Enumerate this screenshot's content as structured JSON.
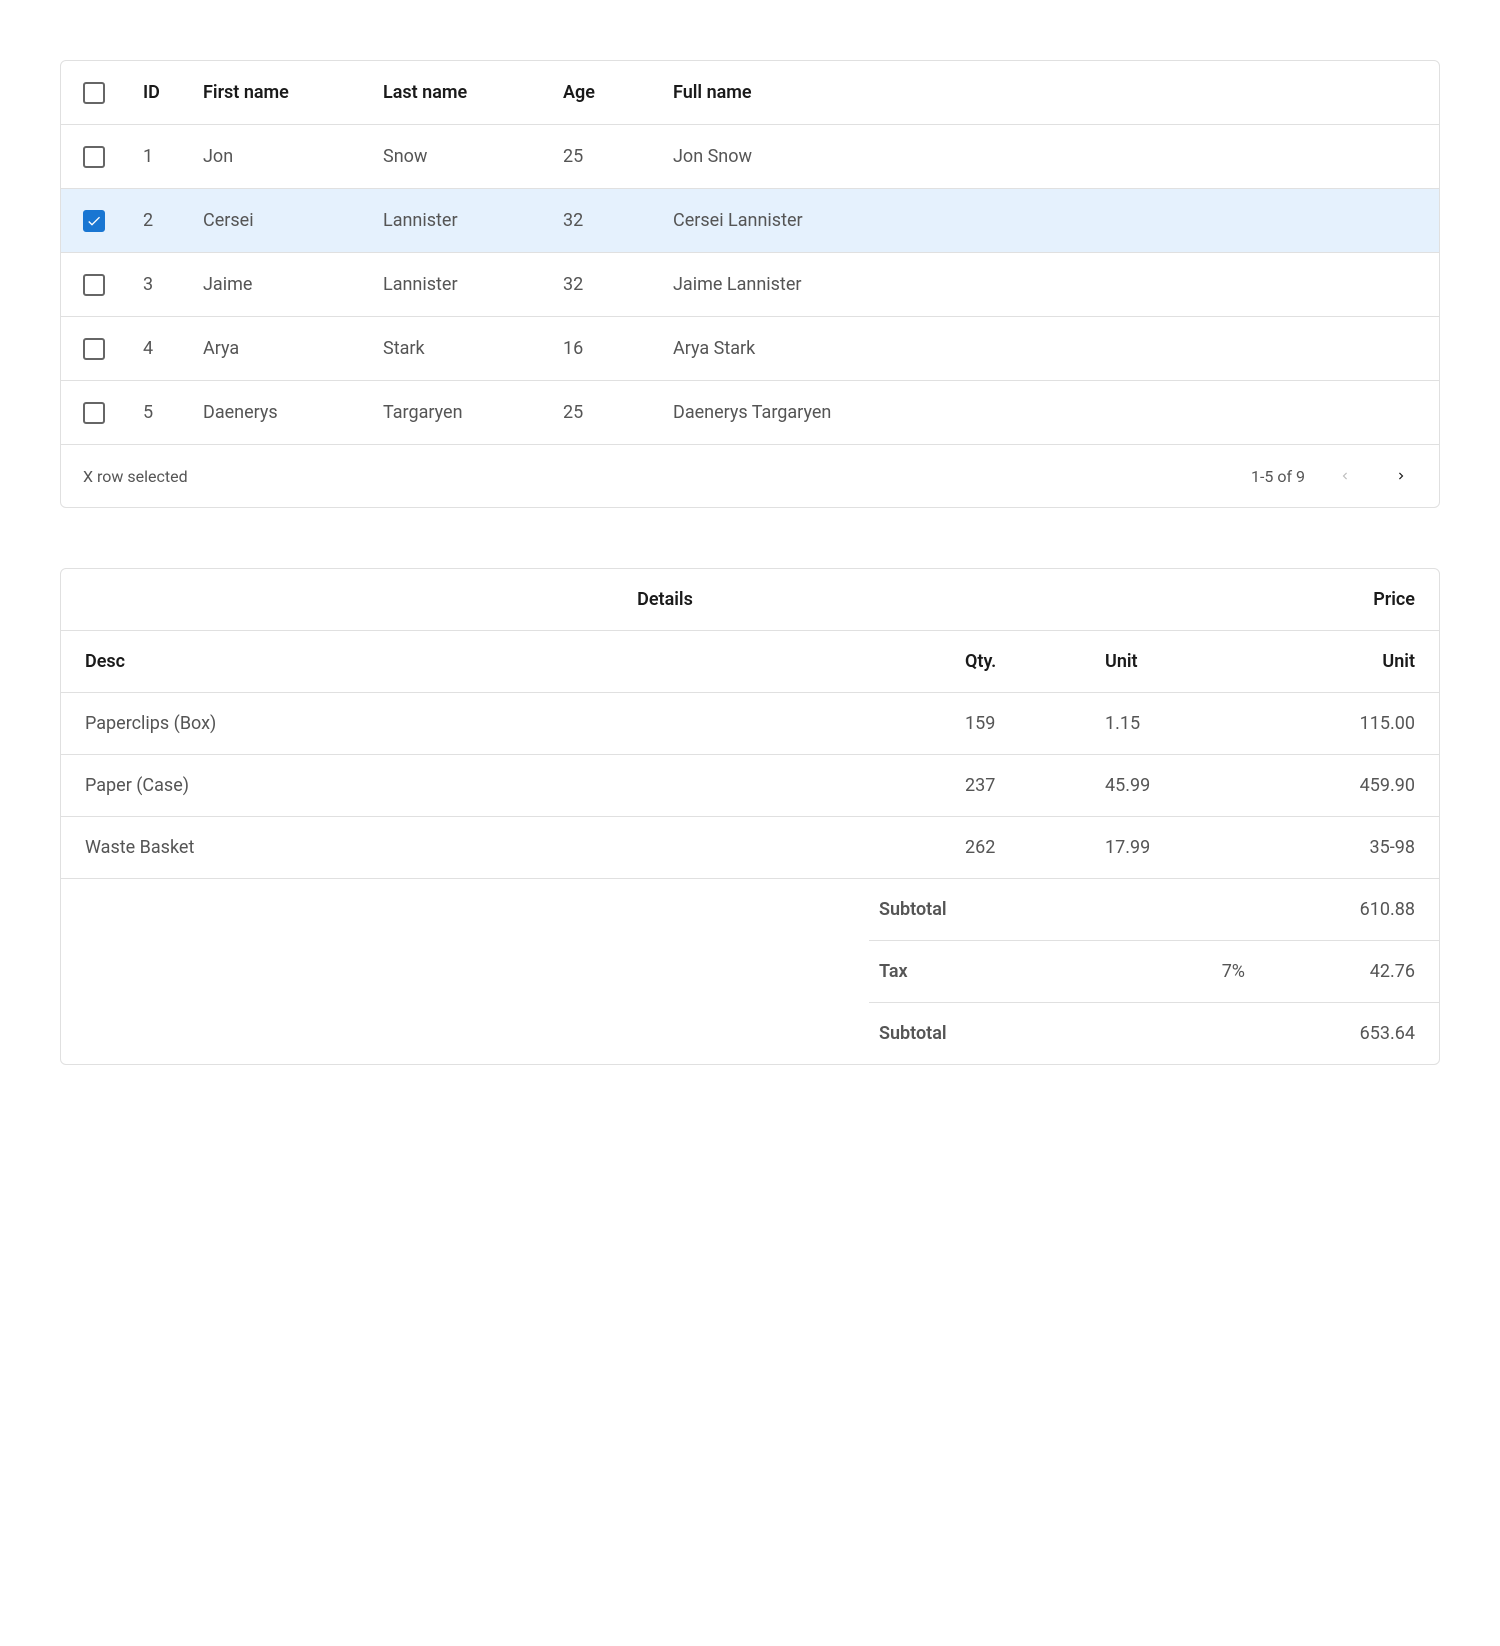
{
  "grid": {
    "headers": {
      "id": "ID",
      "first": "First name",
      "last": "Last name",
      "age": "Age",
      "full": "Full name"
    },
    "rows": [
      {
        "id": "1",
        "first": "Jon",
        "last": "Snow",
        "age": "25",
        "full": "Jon Snow",
        "selected": false
      },
      {
        "id": "2",
        "first": "Cersei",
        "last": "Lannister",
        "age": "32",
        "full": "Cersei Lannister",
        "selected": true
      },
      {
        "id": "3",
        "first": "Jaime",
        "last": "Lannister",
        "age": "32",
        "full": "Jaime Lannister",
        "selected": false
      },
      {
        "id": "4",
        "first": "Arya",
        "last": "Stark",
        "age": "16",
        "full": "Arya Stark",
        "selected": false
      },
      {
        "id": "5",
        "first": "Daenerys",
        "last": "Targaryen",
        "age": "25",
        "full": "Daenerys Targaryen",
        "selected": false
      }
    ],
    "footer": {
      "selection_text": "X row selected",
      "range_text": "1-5 of 9"
    }
  },
  "invoice": {
    "top": {
      "details": "Details",
      "price": "Price"
    },
    "headers": {
      "desc": "Desc",
      "qty": "Qty.",
      "unit": "Unit",
      "unit2": "Unit"
    },
    "rows": [
      {
        "desc": "Paperclips (Box)",
        "qty": "159",
        "unit": "1.15",
        "price": "115.00"
      },
      {
        "desc": "Paper (Case)",
        "qty": "237",
        "unit": "45.99",
        "price": "459.90"
      },
      {
        "desc": "Waste Basket",
        "qty": "262",
        "unit": "17.99",
        "price": "35-98"
      }
    ],
    "summary": [
      {
        "label": "Subtotal",
        "mid": "",
        "val": "610.88"
      },
      {
        "label": "Tax",
        "mid": "7%",
        "val": "42.76"
      },
      {
        "label": "Subtotal",
        "mid": "",
        "val": "653.64"
      }
    ]
  }
}
